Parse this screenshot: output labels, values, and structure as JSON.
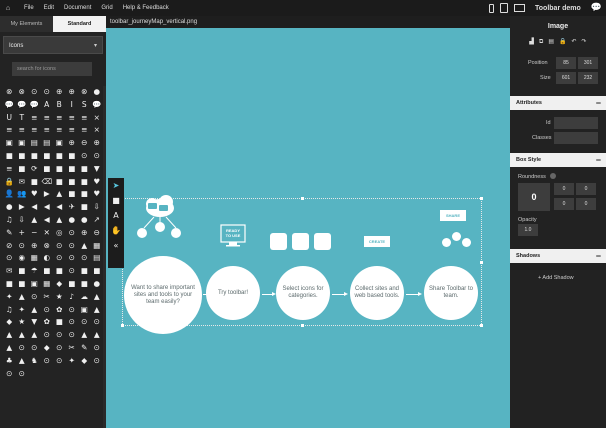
{
  "menubar": {
    "items": [
      "File",
      "Edit",
      "Document",
      "Grid",
      "Help & Feedback"
    ],
    "project_name": "Toolbar demo"
  },
  "left_panel": {
    "tabs": [
      "My Elements",
      "Standard"
    ],
    "category": "Icons",
    "search_placeholder": "search for icons",
    "icons": [
      "⊗",
      "⊗",
      "⊙",
      "⊙",
      "⊕",
      "⊕",
      "⊗",
      "●",
      "💬",
      "💬",
      "💬",
      "A",
      "B",
      "I",
      "S",
      "💬",
      "U",
      "T",
      "≡",
      "≡",
      "≡",
      "≡",
      "≡",
      "⨯",
      "≡",
      "≡",
      "≡",
      "≡",
      "≡",
      "≡",
      "≡",
      "⨯",
      "▣",
      "▣",
      "▤",
      "▤",
      "▣",
      "⊕",
      "⊖",
      "⊕",
      "■",
      "■",
      "■",
      "■",
      "■",
      "■",
      "⊙",
      "⊙",
      "≡",
      "■",
      "⟳",
      "■",
      "■",
      "■",
      "■",
      "▼",
      "🔒",
      "✉",
      "■",
      "⌫",
      "■",
      "■",
      "■",
      "♥",
      "👤",
      "👥",
      "♥",
      "▶",
      "▲",
      "■",
      "■",
      "♥",
      "●",
      "▶",
      "◀",
      "◀",
      "◀",
      "✈",
      "■",
      "⇩",
      "♫",
      "⇩",
      "▲",
      "◀",
      "▲",
      "●",
      "●",
      "↗",
      "✎",
      "+",
      "−",
      "✕",
      "◎",
      "⊙",
      "⊕",
      "⊖",
      "⊘",
      "⊙",
      "⊕",
      "⊗",
      "⊙",
      "⊙",
      "▲",
      "▦",
      "⊙",
      "◉",
      "▦",
      "◐",
      "⊙",
      "⊙",
      "⊙",
      "▤",
      "✉",
      "■",
      "☂",
      "■",
      "■",
      "⊙",
      "■",
      "■",
      "■",
      "■",
      "▣",
      "▦",
      "◆",
      "■",
      "■",
      "●",
      "✦",
      "▲",
      "⊙",
      "✂",
      "★",
      "♪",
      "☁",
      "▲",
      "♫",
      "✦",
      "▲",
      "⊙",
      "✿",
      "⊙",
      "▣",
      "▲",
      "◆",
      "★",
      "▼",
      "✿",
      "■",
      "⊙",
      "⊙",
      "⊙",
      "▲",
      "▲",
      "▲",
      "⊙",
      "⊙",
      "⊙",
      "▲",
      "▲",
      "▲",
      "⊙",
      "⊙",
      "◆",
      "⊙",
      "✂",
      "✎",
      "⊙",
      "♣",
      "▲",
      "♞",
      "⊙",
      "⊙",
      "✦",
      "◆",
      "⊙",
      "⊙",
      "⊙"
    ]
  },
  "canvas": {
    "document_title": "toolbar_journeyMap_vertical.png",
    "steps": [
      "Want to share important sites and tools to your team easily?",
      "Try toolbar!",
      "Select icons for categories.",
      "Collect sites and web based tools.",
      "Share Toolbar to team."
    ],
    "tags": [
      "READY TO USE",
      "CREATE",
      "SHARE"
    ]
  },
  "right_panel": {
    "title": "Image",
    "position_label": "Position",
    "position_x": "85",
    "position_y": "301",
    "size_label": "Size",
    "size_w": "601",
    "size_h": "232",
    "attributes_label": "Attributes",
    "id_label": "Id",
    "classes_label": "Classes",
    "box_style_label": "Box Style",
    "roundness_label": "Roundness",
    "roundness_value": "0",
    "corner_values": [
      "0",
      "0",
      "0",
      "0"
    ],
    "opacity_label": "Opacity",
    "opacity_value": "1.0",
    "shadows_label": "Shadows",
    "add_shadow_label": "+ Add Shadow"
  },
  "colors": {
    "canvas_bg": "#57b4c2",
    "panel_bg": "#232323",
    "accent": "#5ac8e0"
  }
}
